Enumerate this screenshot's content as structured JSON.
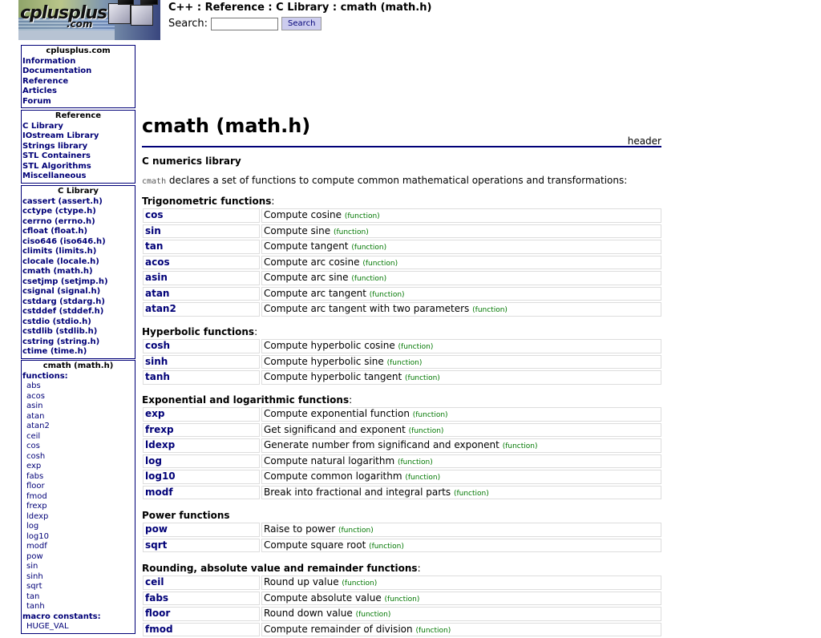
{
  "logo": {
    "word": "cplusplus",
    "com": ".com"
  },
  "header": {
    "breadcrumb": "C++ : Reference : C Library : cmath (math.h)",
    "search_label": "Search:",
    "search_value": "",
    "search_button": "Search"
  },
  "sidebar": {
    "site": {
      "title": "cplusplus.com",
      "items": [
        "Information",
        "Documentation",
        "Reference",
        "Articles",
        "Forum"
      ]
    },
    "reference": {
      "title": "Reference",
      "items": [
        "C Library",
        "IOstream Library",
        "Strings library",
        "STL Containers",
        "STL Algorithms",
        "Miscellaneous"
      ]
    },
    "clibrary": {
      "title": "C Library",
      "items": [
        "cassert (assert.h)",
        "cctype (ctype.h)",
        "cerrno (errno.h)",
        "cfloat (float.h)",
        "ciso646 (iso646.h)",
        "climits (limits.h)",
        "clocale (locale.h)",
        "cmath (math.h)",
        "csetjmp (setjmp.h)",
        "csignal (signal.h)",
        "cstdarg (stdarg.h)",
        "cstddef (stddef.h)",
        "cstdio (stdio.h)",
        "cstdlib (stdlib.h)",
        "cstring (string.h)",
        "ctime (time.h)"
      ]
    },
    "cmath": {
      "title": "cmath (math.h)",
      "functions_label": "functions:",
      "functions": [
        "abs",
        "acos",
        "asin",
        "atan",
        "atan2",
        "ceil",
        "cos",
        "cosh",
        "exp",
        "fabs",
        "floor",
        "fmod",
        "frexp",
        "ldexp",
        "log",
        "log10",
        "modf",
        "pow",
        "sin",
        "sinh",
        "sqrt",
        "tan",
        "tanh"
      ],
      "macros_label": "macro constants:",
      "macros": [
        "HUGE_VAL"
      ]
    }
  },
  "main": {
    "title": "cmath (math.h)",
    "kind": "header",
    "library_name": "C numerics library",
    "desc_code": "cmath",
    "desc_text": " declares a set of functions to compute common mathematical operations and transformations:",
    "tag": "(function)",
    "sections": [
      {
        "title": "Trigonometric functions",
        "colon": true,
        "rows": [
          {
            "name": "cos",
            "desc": "Compute cosine"
          },
          {
            "name": "sin",
            "desc": "Compute sine"
          },
          {
            "name": "tan",
            "desc": "Compute tangent"
          },
          {
            "name": "acos",
            "desc": "Compute arc cosine"
          },
          {
            "name": "asin",
            "desc": "Compute arc sine"
          },
          {
            "name": "atan",
            "desc": "Compute arc tangent"
          },
          {
            "name": "atan2",
            "desc": "Compute arc tangent with two parameters"
          }
        ]
      },
      {
        "title": "Hyperbolic functions",
        "colon": true,
        "rows": [
          {
            "name": "cosh",
            "desc": "Compute hyperbolic cosine"
          },
          {
            "name": "sinh",
            "desc": "Compute hyperbolic sine"
          },
          {
            "name": "tanh",
            "desc": "Compute hyperbolic tangent"
          }
        ]
      },
      {
        "title": "Exponential and logarithmic functions",
        "colon": true,
        "rows": [
          {
            "name": "exp",
            "desc": "Compute exponential function"
          },
          {
            "name": "frexp",
            "desc": "Get significand and exponent"
          },
          {
            "name": "ldexp",
            "desc": "Generate number from significand and exponent"
          },
          {
            "name": "log",
            "desc": "Compute natural logarithm"
          },
          {
            "name": "log10",
            "desc": "Compute common logarithm"
          },
          {
            "name": "modf",
            "desc": "Break into fractional and integral parts"
          }
        ]
      },
      {
        "title": "Power functions",
        "colon": false,
        "rows": [
          {
            "name": "pow",
            "desc": "Raise to power"
          },
          {
            "name": "sqrt",
            "desc": "Compute square root"
          }
        ]
      },
      {
        "title": "Rounding, absolute value and remainder functions",
        "colon": true,
        "rows": [
          {
            "name": "ceil",
            "desc": "Round up value"
          },
          {
            "name": "fabs",
            "desc": "Compute absolute value"
          },
          {
            "name": "floor",
            "desc": "Round down value"
          },
          {
            "name": "fmod",
            "desc": "Compute remainder of division"
          }
        ]
      }
    ]
  }
}
